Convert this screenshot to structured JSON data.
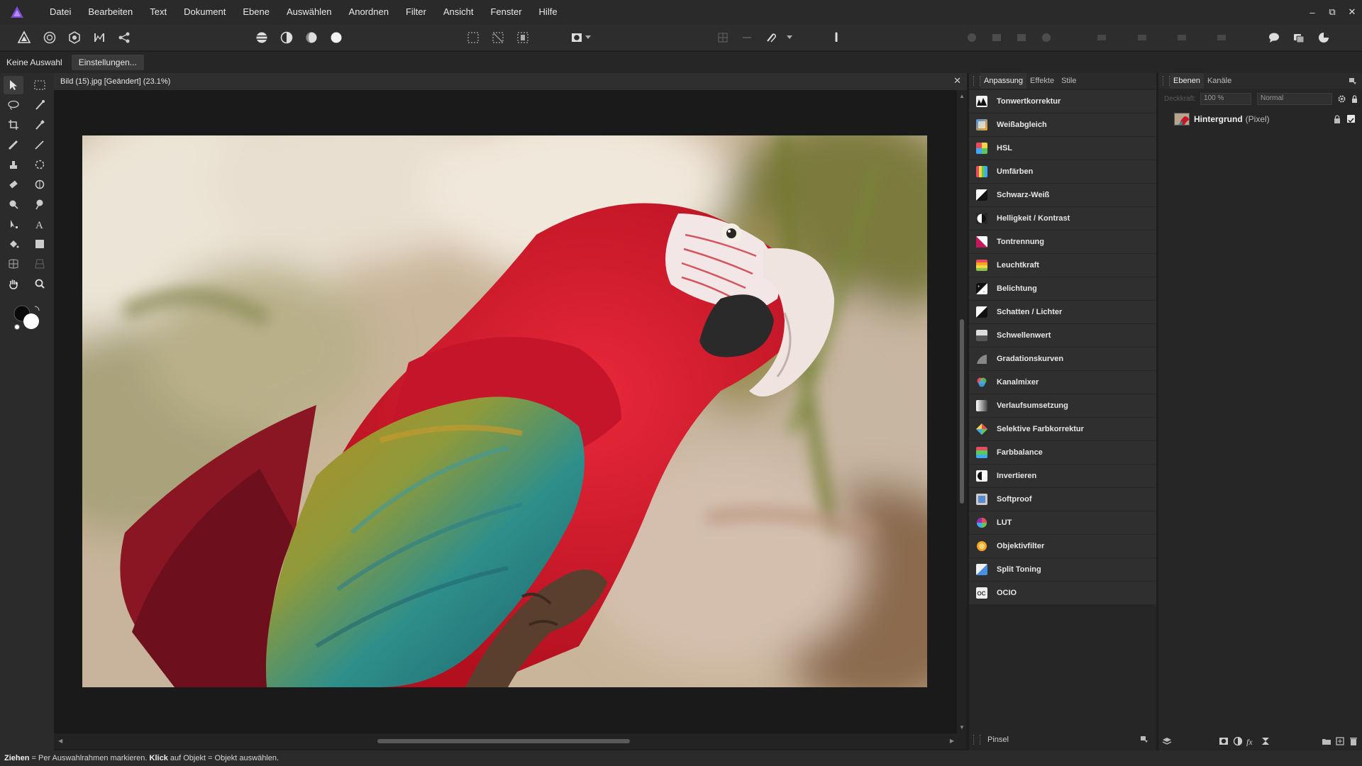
{
  "menu": [
    "Datei",
    "Bearbeiten",
    "Text",
    "Dokument",
    "Ebene",
    "Auswählen",
    "Anordnen",
    "Filter",
    "Ansicht",
    "Fenster",
    "Hilfe"
  ],
  "window_controls": {
    "minimize": "–",
    "restore": "⧉",
    "close": "✕"
  },
  "context": {
    "selection": "Keine Auswahl",
    "settings_button": "Einstellungen..."
  },
  "document": {
    "title": "Bild (15).jpg [Geändert] (23.1%)",
    "close": "✕"
  },
  "adjustment_tabs": [
    "Anpassung",
    "Effekte",
    "Stile"
  ],
  "adjustments": [
    {
      "label": "Tonwertkorrektur",
      "icon": "levels-icon"
    },
    {
      "label": "Weißabgleich",
      "icon": "white-balance-icon"
    },
    {
      "label": "HSL",
      "icon": "hsl-icon"
    },
    {
      "label": "Umfärben",
      "icon": "recolor-icon"
    },
    {
      "label": "Schwarz-Weiß",
      "icon": "black-white-icon"
    },
    {
      "label": "Helligkeit / Kontrast",
      "icon": "brightness-contrast-icon"
    },
    {
      "label": "Tontrennung",
      "icon": "posterize-icon"
    },
    {
      "label": "Leuchtkraft",
      "icon": "vibrance-icon"
    },
    {
      "label": "Belichtung",
      "icon": "exposure-icon"
    },
    {
      "label": "Schatten / Lichter",
      "icon": "shadows-highlights-icon"
    },
    {
      "label": "Schwellenwert",
      "icon": "threshold-icon"
    },
    {
      "label": "Gradationskurven",
      "icon": "curves-icon"
    },
    {
      "label": "Kanalmixer",
      "icon": "channel-mixer-icon"
    },
    {
      "label": "Verlaufsumsetzung",
      "icon": "gradient-map-icon"
    },
    {
      "label": "Selektive Farbkorrektur",
      "icon": "selective-color-icon"
    },
    {
      "label": "Farbbalance",
      "icon": "color-balance-icon"
    },
    {
      "label": "Invertieren",
      "icon": "invert-icon"
    },
    {
      "label": "Softproof",
      "icon": "soft-proof-icon"
    },
    {
      "label": "LUT",
      "icon": "lut-icon"
    },
    {
      "label": "Objektivfilter",
      "icon": "lens-filter-icon"
    },
    {
      "label": "Split Toning",
      "icon": "split-toning-icon"
    },
    {
      "label": "OCIO",
      "icon": "ocio-icon"
    }
  ],
  "adj_footer": {
    "label": "Pinsel"
  },
  "layers_tabs": [
    "Ebenen",
    "Kanäle"
  ],
  "layers_opts": {
    "opacity_label": "Deckkraft:",
    "opacity": "100 %",
    "blend_mode": "Normal"
  },
  "layer": {
    "name": "Hintergrund",
    "type": "(Pixel)"
  },
  "status": {
    "ziehen": "Ziehen",
    "ziehen_desc": " = Per Auswahlrahmen markieren. ",
    "klick": "Klick",
    "klick_desc": " auf Objekt = Objekt auswählen."
  },
  "colors": {
    "accent": "#7b4fd6",
    "panel_bg": "#262626",
    "item_bg": "#2f2f2f",
    "canvas_bg": "#1a1a1a"
  }
}
